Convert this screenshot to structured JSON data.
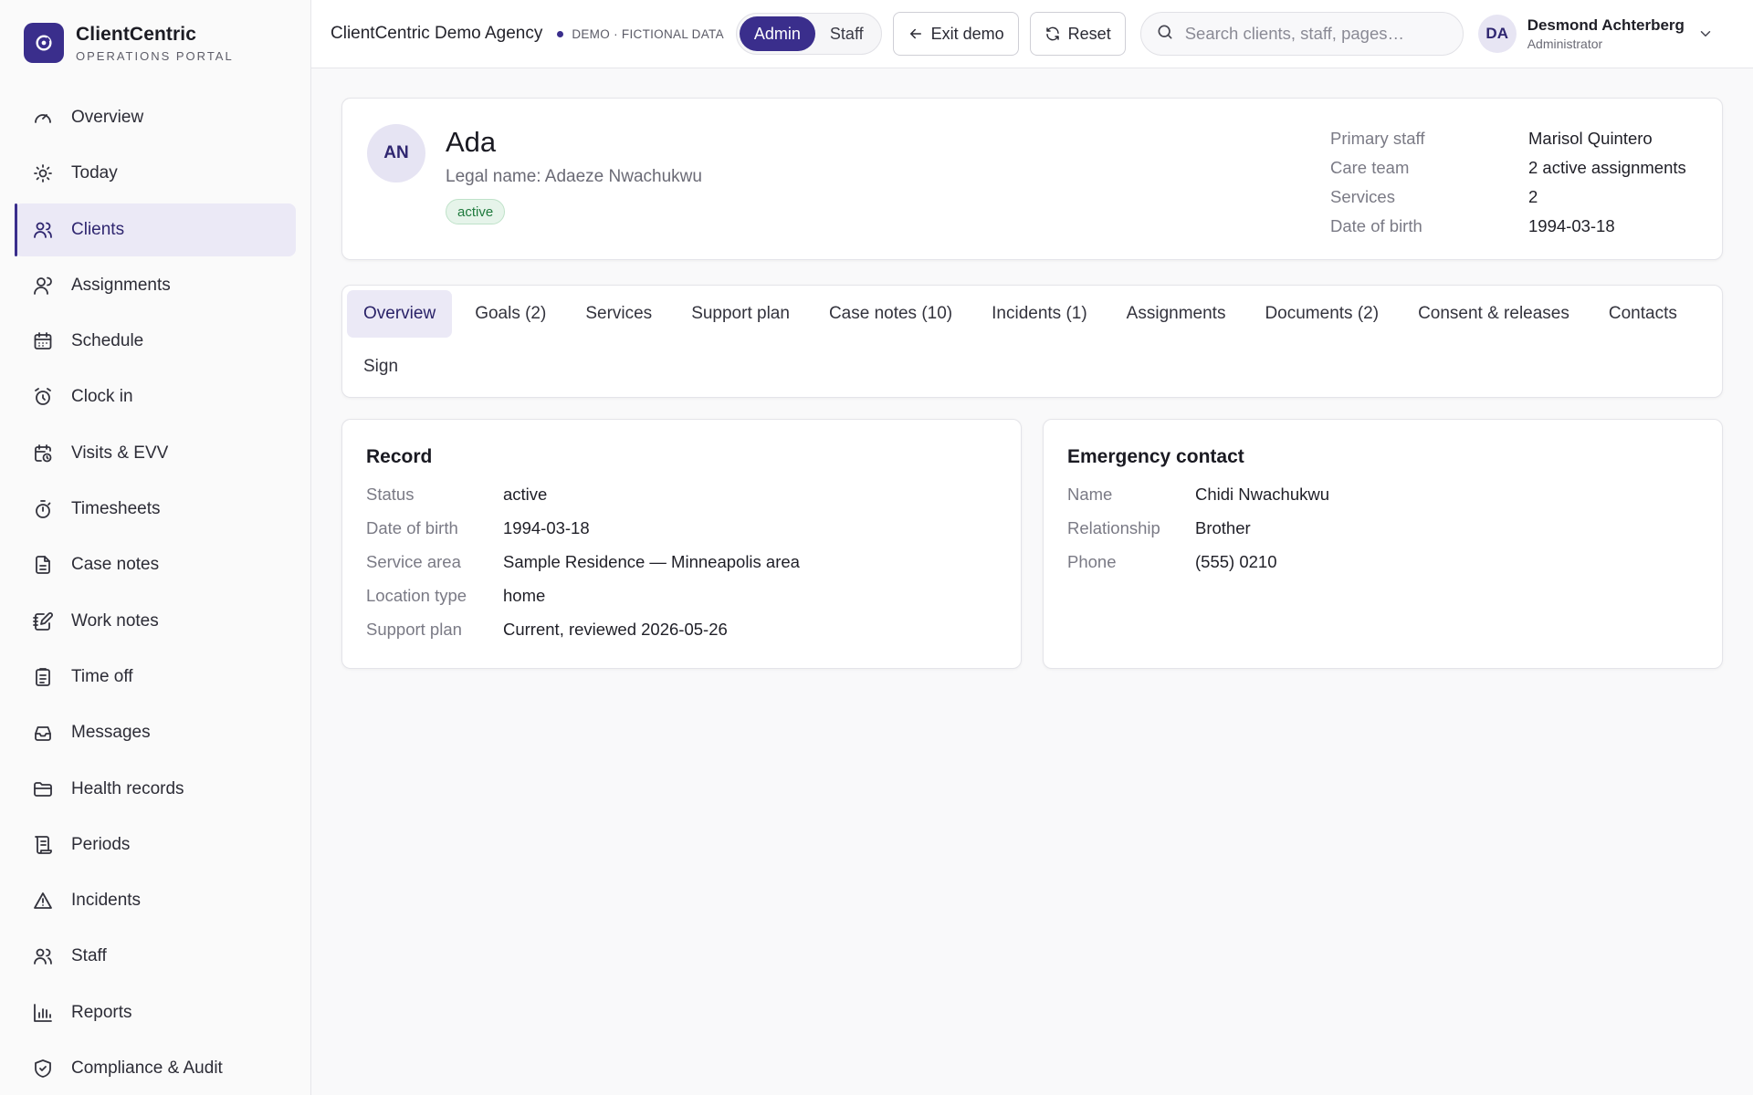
{
  "brand": {
    "name": "ClientCentric",
    "subtitle": "OPERATIONS PORTAL"
  },
  "sidebar": {
    "items": [
      {
        "label": "Overview",
        "icon": "gauge-icon",
        "active": false
      },
      {
        "label": "Today",
        "icon": "sun-icon",
        "active": false
      },
      {
        "label": "Clients",
        "icon": "users-icon",
        "active": true
      },
      {
        "label": "Assignments",
        "icon": "user-link-icon",
        "active": false
      },
      {
        "label": "Schedule",
        "icon": "calendar-icon",
        "active": false
      },
      {
        "label": "Clock in",
        "icon": "alarm-clock-icon",
        "active": false
      },
      {
        "label": "Visits & EVV",
        "icon": "calendar-clock-icon",
        "active": false
      },
      {
        "label": "Timesheets",
        "icon": "stopwatch-icon",
        "active": false
      },
      {
        "label": "Case notes",
        "icon": "document-icon",
        "active": false
      },
      {
        "label": "Work notes",
        "icon": "notebook-pen-icon",
        "active": false
      },
      {
        "label": "Time off",
        "icon": "clipboard-icon",
        "active": false
      },
      {
        "label": "Messages",
        "icon": "inbox-icon",
        "active": false
      },
      {
        "label": "Health records",
        "icon": "folder-icon",
        "active": false
      },
      {
        "label": "Periods",
        "icon": "scroll-icon",
        "active": false
      },
      {
        "label": "Incidents",
        "icon": "warning-icon",
        "active": false
      },
      {
        "label": "Staff",
        "icon": "users-icon",
        "active": false
      },
      {
        "label": "Reports",
        "icon": "bar-chart-icon",
        "active": false
      },
      {
        "label": "Compliance & Audit",
        "icon": "shield-check-icon",
        "active": false
      }
    ]
  },
  "topbar": {
    "agency": "ClientCentric Demo Agency",
    "demo_tag": "DEMO · FICTIONAL DATA",
    "roles": {
      "admin": "Admin",
      "staff": "Staff",
      "selected": "Admin"
    },
    "exit_label": "Exit demo",
    "reset_label": "Reset",
    "search_placeholder": "Search clients, staff, pages…",
    "user": {
      "initials": "DA",
      "name": "Desmond Achterberg",
      "role": "Administrator"
    }
  },
  "client": {
    "initials": "AN",
    "name": "Ada",
    "legal_name": "Legal name: Adaeze Nwachukwu",
    "status": "active",
    "meta": {
      "primary_staff_label": "Primary staff",
      "primary_staff": "Marisol Quintero",
      "care_team_label": "Care team",
      "care_team": "2 active assignments",
      "services_label": "Services",
      "services": "2",
      "dob_label": "Date of birth",
      "dob": "1994-03-18"
    }
  },
  "tabs": [
    "Overview",
    "Goals (2)",
    "Services",
    "Support plan",
    "Case notes (10)",
    "Incidents (1)",
    "Assignments",
    "Documents (2)",
    "Consent & releases",
    "Contacts",
    "Sign"
  ],
  "active_tab": "Overview",
  "record": {
    "title": "Record",
    "rows": [
      {
        "label": "Status",
        "value": "active"
      },
      {
        "label": "Date of birth",
        "value": "1994-03-18"
      },
      {
        "label": "Service area",
        "value": "Sample Residence — Minneapolis area"
      },
      {
        "label": "Location type",
        "value": "home"
      },
      {
        "label": "Support plan",
        "value": "Current, reviewed 2026-05-26"
      }
    ]
  },
  "emergency_contact": {
    "title": "Emergency contact",
    "rows": [
      {
        "label": "Name",
        "value": "Chidi Nwachukwu"
      },
      {
        "label": "Relationship",
        "value": "Brother"
      },
      {
        "label": "Phone",
        "value": "(555) 0210"
      }
    ]
  },
  "colors": {
    "accent": "#3a2e8c",
    "active_bg": "#ebe9f6",
    "status_green": "#1f7a3d"
  }
}
